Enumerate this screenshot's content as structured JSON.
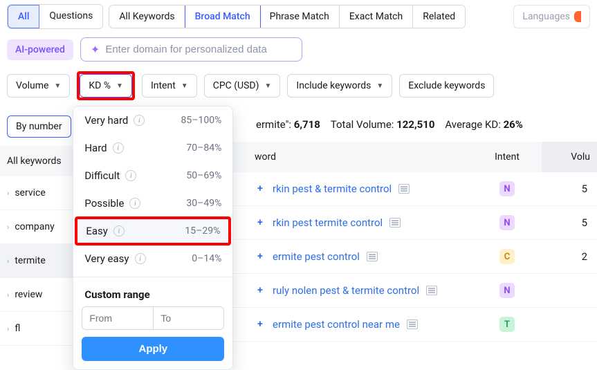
{
  "topbar": {
    "tabs_group1": [
      "All",
      "Questions"
    ],
    "tabs_group2": [
      "All Keywords",
      "Broad Match",
      "Phrase Match",
      "Exact Match",
      "Related"
    ],
    "active_g1": "All",
    "active_g2": "Broad Match",
    "languages_label": "Languages"
  },
  "ai": {
    "badge": "AI-powered",
    "placeholder": "Enter domain for personalized data"
  },
  "filters": {
    "volume": "Volume",
    "kd": "KD %",
    "intent": "Intent",
    "cpc": "CPC (USD)",
    "include": "Include keywords",
    "exclude": "Exclude keywords"
  },
  "kd_dropdown": {
    "items": [
      {
        "label": "Very hard",
        "range": "85–100%"
      },
      {
        "label": "Hard",
        "range": "70–84%"
      },
      {
        "label": "Difficult",
        "range": "50–69%"
      },
      {
        "label": "Possible",
        "range": "30–49%"
      },
      {
        "label": "Easy",
        "range": "15–29%"
      },
      {
        "label": "Very easy",
        "range": "0–14%"
      }
    ],
    "custom_label": "Custom range",
    "from_ph": "From",
    "to_ph": "To",
    "apply": "Apply"
  },
  "by_number": "By number",
  "stats": {
    "prefix": "ermite\": ",
    "count": "6,718",
    "tv_label": "Total Volume: ",
    "tv": "122,510",
    "akd_label": "Average KD: ",
    "akd": "26%"
  },
  "left_header": "All keywords",
  "side_items": [
    "service",
    "company",
    "termite",
    "review",
    "fl"
  ],
  "side_active": "termite",
  "table": {
    "h_keyword": "word",
    "h_intent": "Intent",
    "h_volume": "Volu"
  },
  "rows": [
    {
      "kw": "rkin pest & termite control",
      "intent": "N",
      "vol": "5"
    },
    {
      "kw": "rkin pest termite control",
      "intent": "N",
      "vol": "5"
    },
    {
      "kw": "ermite pest control",
      "intent": "C",
      "vol": "2"
    },
    {
      "kw": "ruly nolen pest & termite control",
      "intent": "N",
      "vol": ""
    },
    {
      "kw": "ermite pest control near me",
      "intent": "T",
      "vol": ""
    }
  ]
}
